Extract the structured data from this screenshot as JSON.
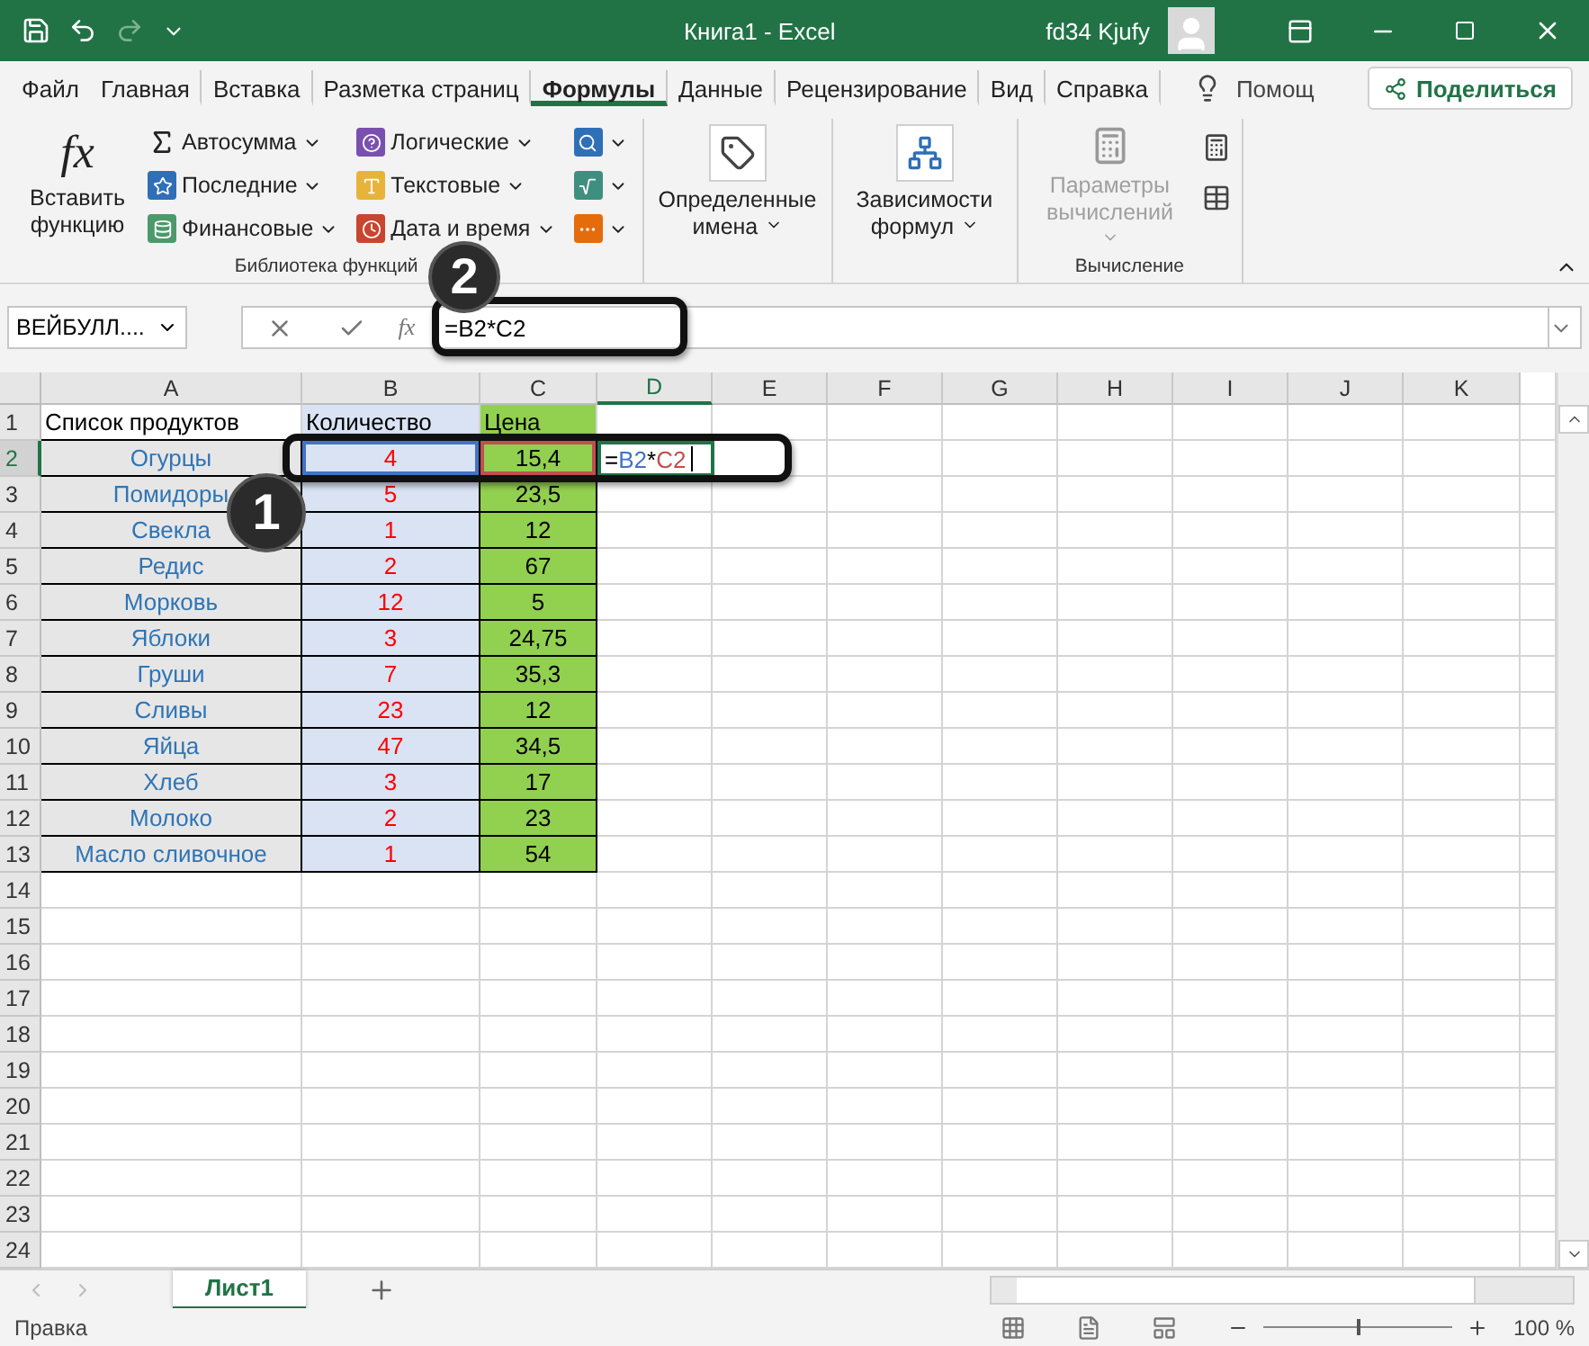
{
  "title_bar": {
    "title": "Книга1  -  Excel",
    "user": "fd34 Kjufy",
    "redo_disabled": true
  },
  "menu_tabs": [
    {
      "label": "Файл",
      "selected": false
    },
    {
      "label": "Главная",
      "selected": false
    },
    {
      "label": "Вставка",
      "selected": false
    },
    {
      "label": "Разметка страниц",
      "selected": false
    },
    {
      "label": "Формулы",
      "selected": true
    },
    {
      "label": "Данные",
      "selected": false
    },
    {
      "label": "Рецензирование",
      "selected": false
    },
    {
      "label": "Вид",
      "selected": false
    },
    {
      "label": "Справка",
      "selected": false
    }
  ],
  "tell_me": "Помощ",
  "share": "Поделиться",
  "ribbon": {
    "insert_function": {
      "icon": "fx",
      "label": "Вставить функцию"
    },
    "library_columns": [
      [
        {
          "kind": "sum",
          "label": "Автосумма"
        },
        {
          "kind": "recent",
          "label": "Последние"
        },
        {
          "kind": "finance",
          "label": "Финансовые"
        }
      ],
      [
        {
          "kind": "logic",
          "label": "Логические"
        },
        {
          "kind": "text",
          "label": "Текстовые"
        },
        {
          "kind": "date",
          "label": "Дата и время"
        }
      ],
      [
        {
          "kind": "lookup"
        },
        {
          "kind": "math"
        },
        {
          "kind": "more"
        }
      ]
    ],
    "library_label": "Библиотека функций",
    "big_buttons": [
      {
        "kind": "names",
        "label": "Определенные имена",
        "disabled": false
      },
      {
        "kind": "audit",
        "label": "Зависимости формул",
        "disabled": false
      },
      {
        "kind": "calc",
        "label": "Параметры вычислений",
        "disabled": true
      }
    ],
    "calc_label": "Вычисление"
  },
  "formula_bar": {
    "name_box": "ВЕЙБУЛЛ....",
    "fx": "fx",
    "formula": "=B2*C2"
  },
  "columns": [
    {
      "label": "A",
      "selected": false
    },
    {
      "label": "B",
      "selected": false
    },
    {
      "label": "C",
      "selected": false
    },
    {
      "label": "D",
      "selected": true
    },
    {
      "label": "E",
      "selected": false
    },
    {
      "label": "F",
      "selected": false
    },
    {
      "label": "G",
      "selected": false
    },
    {
      "label": "H",
      "selected": false
    },
    {
      "label": "I",
      "selected": false
    },
    {
      "label": "J",
      "selected": false
    },
    {
      "label": "K",
      "selected": false
    }
  ],
  "rows": [
    {
      "number": "1",
      "selected": false,
      "kind": "title",
      "cells": [
        {
          "text": "Список продуктов"
        },
        {
          "text": "Количество"
        },
        {
          "text": "Цена"
        }
      ]
    },
    {
      "number": "2",
      "selected": true,
      "kind": "item",
      "cells": [
        {
          "text": "Огурцы"
        },
        {
          "text": "4",
          "color": "#4472c4"
        },
        {
          "text": "15,4",
          "color": "#c0504d"
        }
      ],
      "edit": [
        {
          "text": "=",
          "color": "#000000"
        },
        {
          "text": "B2",
          "color": "#4472c4"
        },
        {
          "text": "*",
          "color": "#000000"
        },
        {
          "text": "C2",
          "color": "#c0504d"
        }
      ]
    },
    {
      "number": "3",
      "selected": false,
      "kind": "item",
      "cells": [
        {
          "text": "Помидоры"
        },
        {
          "text": "5"
        },
        {
          "text": "23,5"
        }
      ]
    },
    {
      "number": "4",
      "selected": false,
      "kind": "item",
      "cells": [
        {
          "text": "Свекла"
        },
        {
          "text": "1"
        },
        {
          "text": "12"
        }
      ]
    },
    {
      "number": "5",
      "selected": false,
      "kind": "item",
      "cells": [
        {
          "text": "Редис"
        },
        {
          "text": "2"
        },
        {
          "text": "67"
        }
      ]
    },
    {
      "number": "6",
      "selected": false,
      "kind": "item",
      "cells": [
        {
          "text": "Морковь"
        },
        {
          "text": "12"
        },
        {
          "text": "5"
        }
      ]
    },
    {
      "number": "7",
      "selected": false,
      "kind": "item",
      "cells": [
        {
          "text": "Яблоки"
        },
        {
          "text": "3"
        },
        {
          "text": "24,75"
        }
      ]
    },
    {
      "number": "8",
      "selected": false,
      "kind": "item",
      "cells": [
        {
          "text": "Груши"
        },
        {
          "text": "7"
        },
        {
          "text": "35,3"
        }
      ]
    },
    {
      "number": "9",
      "selected": false,
      "kind": "item",
      "cells": [
        {
          "text": "Сливы"
        },
        {
          "text": "23"
        },
        {
          "text": "12"
        }
      ]
    },
    {
      "number": "10",
      "selected": false,
      "kind": "item",
      "cells": [
        {
          "text": "Яйца"
        },
        {
          "text": "47"
        },
        {
          "text": "34,5"
        }
      ]
    },
    {
      "number": "11",
      "selected": false,
      "kind": "item",
      "cells": [
        {
          "text": "Хлеб"
        },
        {
          "text": "3"
        },
        {
          "text": "17"
        }
      ]
    },
    {
      "number": "12",
      "selected": false,
      "kind": "item",
      "cells": [
        {
          "text": "Молоко"
        },
        {
          "text": "2"
        },
        {
          "text": "23"
        }
      ]
    },
    {
      "number": "13",
      "selected": false,
      "kind": "item",
      "cells": [
        {
          "text": "Масло сливочное"
        },
        {
          "text": "1"
        },
        {
          "text": "54"
        }
      ]
    },
    {
      "number": "14",
      "selected": false,
      "kind": "empty"
    },
    {
      "number": "15",
      "selected": false,
      "kind": "empty"
    },
    {
      "number": "16",
      "selected": false,
      "kind": "empty"
    },
    {
      "number": "17",
      "selected": false,
      "kind": "empty"
    },
    {
      "number": "18",
      "selected": false,
      "kind": "empty"
    },
    {
      "number": "19",
      "selected": false,
      "kind": "empty"
    },
    {
      "number": "20",
      "selected": false,
      "kind": "empty"
    },
    {
      "number": "21",
      "selected": false,
      "kind": "empty"
    },
    {
      "number": "22",
      "selected": false,
      "kind": "empty"
    },
    {
      "number": "23",
      "selected": false,
      "kind": "empty"
    },
    {
      "number": "24",
      "selected": false,
      "kind": "empty"
    }
  ],
  "callouts": [
    {
      "number": "1"
    },
    {
      "number": "2"
    }
  ],
  "sheets": [
    {
      "label": "Лист1",
      "selected": true
    }
  ],
  "status_bar": {
    "mode": "Правка",
    "zoom": {
      "level": 0.5,
      "reading": "100 %"
    }
  }
}
